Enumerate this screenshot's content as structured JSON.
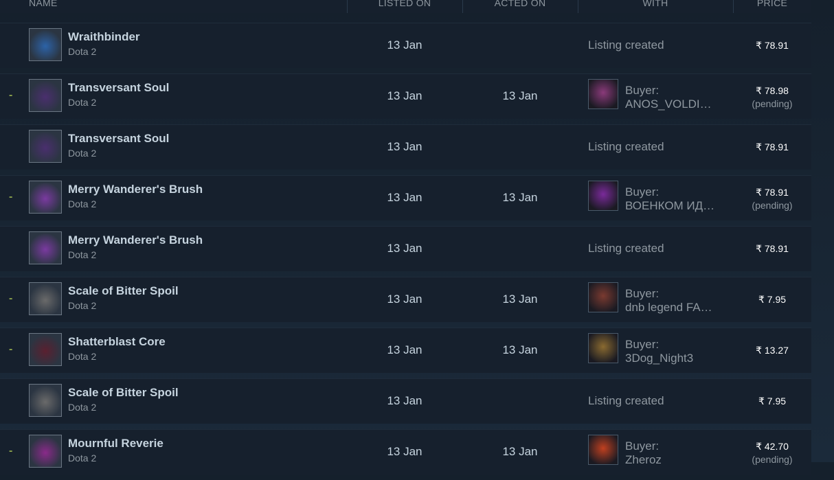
{
  "header": {
    "name": "NAME",
    "listed_on": "LISTED ON",
    "acted_on": "ACTED ON",
    "with": "WITH",
    "price": "PRICE"
  },
  "rows": [
    {
      "gain": "",
      "item": "Wraithbinder",
      "game": "Dota 2",
      "listed": "13 Jan",
      "acted": "",
      "with": "Listing created",
      "buyer_label": "",
      "buyer": "",
      "price": "₹ 78.91",
      "pending": "",
      "thumb_color": "#2c63a8",
      "avatar_color": ""
    },
    {
      "gain": "-",
      "item": "Transversant Soul",
      "game": "Dota 2",
      "listed": "13 Jan",
      "acted": "13 Jan",
      "with": "",
      "buyer_label": "Buyer:",
      "buyer": "ANOS_VOLDI…",
      "price": "₹ 78.98",
      "pending": "(pending)",
      "thumb_color": "#4a2f6e",
      "avatar_color": "#8a3a7a"
    },
    {
      "gain": "",
      "item": "Transversant Soul",
      "game": "Dota 2",
      "listed": "13 Jan",
      "acted": "",
      "with": "Listing created",
      "buyer_label": "",
      "buyer": "",
      "price": "₹ 78.91",
      "pending": "",
      "thumb_color": "#4a2f6e",
      "avatar_color": ""
    },
    {
      "gain": "-",
      "item": "Merry Wanderer's Brush",
      "game": "Dota 2",
      "listed": "13 Jan",
      "acted": "13 Jan",
      "with": "",
      "buyer_label": "Buyer:",
      "buyer": "ВОЕНКОМ ИД…",
      "price": "₹ 78.91",
      "pending": "(pending)",
      "thumb_color": "#7a3aa0",
      "avatar_color": "#7a2a9a"
    },
    {
      "gain": "",
      "item": "Merry Wanderer's Brush",
      "game": "Dota 2",
      "listed": "13 Jan",
      "acted": "",
      "with": "Listing created",
      "buyer_label": "",
      "buyer": "",
      "price": "₹ 78.91",
      "pending": "",
      "thumb_color": "#7a3aa0",
      "avatar_color": ""
    },
    {
      "gain": "-",
      "item": "Scale of Bitter Spoil",
      "game": "Dota 2",
      "listed": "13 Jan",
      "acted": "13 Jan",
      "with": "",
      "buyer_label": "Buyer:",
      "buyer": "dnb legend FA…",
      "price": "₹ 7.95",
      "pending": "",
      "thumb_color": "#6a6a6a",
      "avatar_color": "#7a3a30"
    },
    {
      "gain": "-",
      "item": "Shatterblast Core",
      "game": "Dota 2",
      "listed": "13 Jan",
      "acted": "13 Jan",
      "with": "",
      "buyer_label": "Buyer:",
      "buyer": "3Dog_Night3",
      "price": "₹ 13.27",
      "pending": "",
      "thumb_color": "#5a2030",
      "avatar_color": "#8a6a30"
    },
    {
      "gain": "",
      "item": "Scale of Bitter Spoil",
      "game": "Dota 2",
      "listed": "13 Jan",
      "acted": "",
      "with": "Listing created",
      "buyer_label": "",
      "buyer": "",
      "price": "₹ 7.95",
      "pending": "",
      "thumb_color": "#6a6a6a",
      "avatar_color": ""
    },
    {
      "gain": "-",
      "item": "Mournful Reverie",
      "game": "Dota 2",
      "listed": "13 Jan",
      "acted": "13 Jan",
      "with": "",
      "buyer_label": "Buyer:",
      "buyer": "Zheroz",
      "price": "₹ 42.70",
      "pending": "(pending)",
      "thumb_color": "#8a2a8a",
      "avatar_color": "#c04020"
    }
  ]
}
